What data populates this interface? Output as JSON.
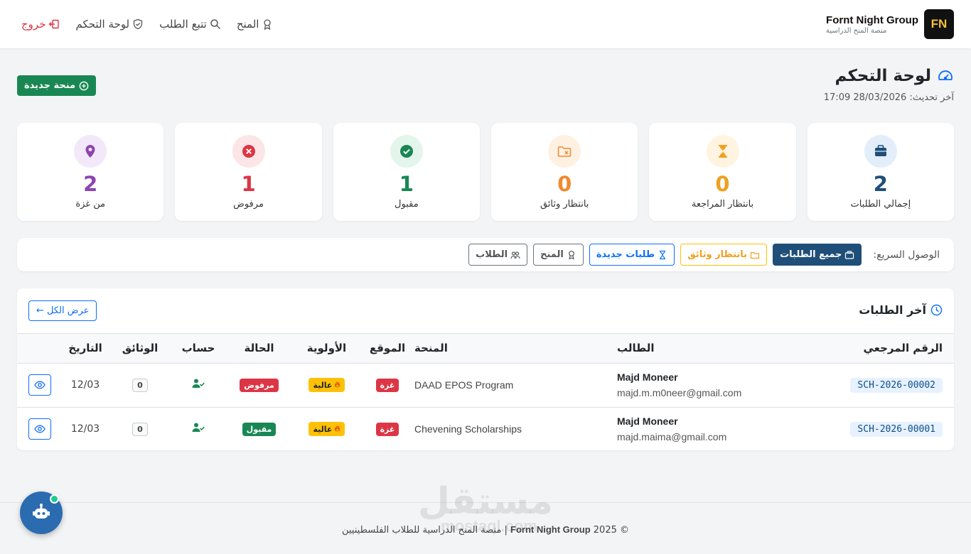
{
  "brand": {
    "name": "Fornt Night Group",
    "subtitle": "منصة المنح الدراسية",
    "logo_text": "FN"
  },
  "nav": {
    "scholarships": "المنح",
    "track": "تتبع الطلب",
    "dashboard": "لوحة التحكم",
    "logout": "خروج"
  },
  "header": {
    "title": "لوحة التحكم",
    "last_update": "آخر تحديث: 28/03/2026 17:09",
    "new_button": "منحة جديدة"
  },
  "stats": [
    {
      "label": "إجمالي الطلبات",
      "value": "2",
      "color": "#1f4e79",
      "bg": "#e3eefa",
      "icon": "briefcase-icon"
    },
    {
      "label": "بانتظار المراجعة",
      "value": "0",
      "color": "#f0a020",
      "bg": "#fff4e0",
      "icon": "hourglass-icon"
    },
    {
      "label": "بانتظار وثائق",
      "value": "0",
      "color": "#f08a30",
      "bg": "#fff1e2",
      "icon": "folder-x-icon"
    },
    {
      "label": "مقبول",
      "value": "1",
      "color": "#198754",
      "bg": "#e4f5ec",
      "icon": "check-circle-icon"
    },
    {
      "label": "مرفوض",
      "value": "1",
      "color": "#dc3545",
      "bg": "#fbe5e7",
      "icon": "x-circle-icon"
    },
    {
      "label": "من غزة",
      "value": "2",
      "color": "#8e44ad",
      "bg": "#f3e8f9",
      "icon": "map-pin-icon"
    }
  ],
  "quick": {
    "label": "الوصول السريع:",
    "all_requests": "جميع الطلبات",
    "awaiting_docs": "بانتظار وثائق",
    "new_requests": "طلبات جديدة",
    "scholarships": "المنح",
    "students": "الطلاب"
  },
  "latest": {
    "title": "آخر الطلبات",
    "view_all": "عرض الكل ←",
    "columns": {
      "ref": "الرقم المرجعي",
      "student": "الطالب",
      "scholarship": "المنحة",
      "location": "الموقع",
      "priority": "الأولوية",
      "status": "الحالة",
      "account": "حساب",
      "documents": "الوثائق",
      "date": "التاريخ"
    },
    "rows": [
      {
        "ref": "SCH-2026-00002",
        "name": "Majd Moneer",
        "email": "majd.m.m0neer@gmail.com",
        "scholarship": "DAAD EPOS Program",
        "location": "غزة",
        "priority": "عالية",
        "status": "مرفوض",
        "status_color": "#dc3545",
        "docs": "0",
        "date": "12/03"
      },
      {
        "ref": "SCH-2026-00001",
        "name": "Majd Moneer",
        "email": "majd.maima@gmail.com",
        "scholarship": "Chevening Scholarships",
        "location": "غزة",
        "priority": "عالية",
        "status": "مقبول",
        "status_color": "#198754",
        "docs": "0",
        "date": "12/03"
      }
    ]
  },
  "footer": {
    "copyright": "© 2025",
    "brand": "Fornt Night Group",
    "text": "| منصة المنح الدراسية للطلاب الفلسطينيين"
  },
  "watermark": {
    "arabic": "مستقل",
    "latin": "mostaql.com"
  }
}
